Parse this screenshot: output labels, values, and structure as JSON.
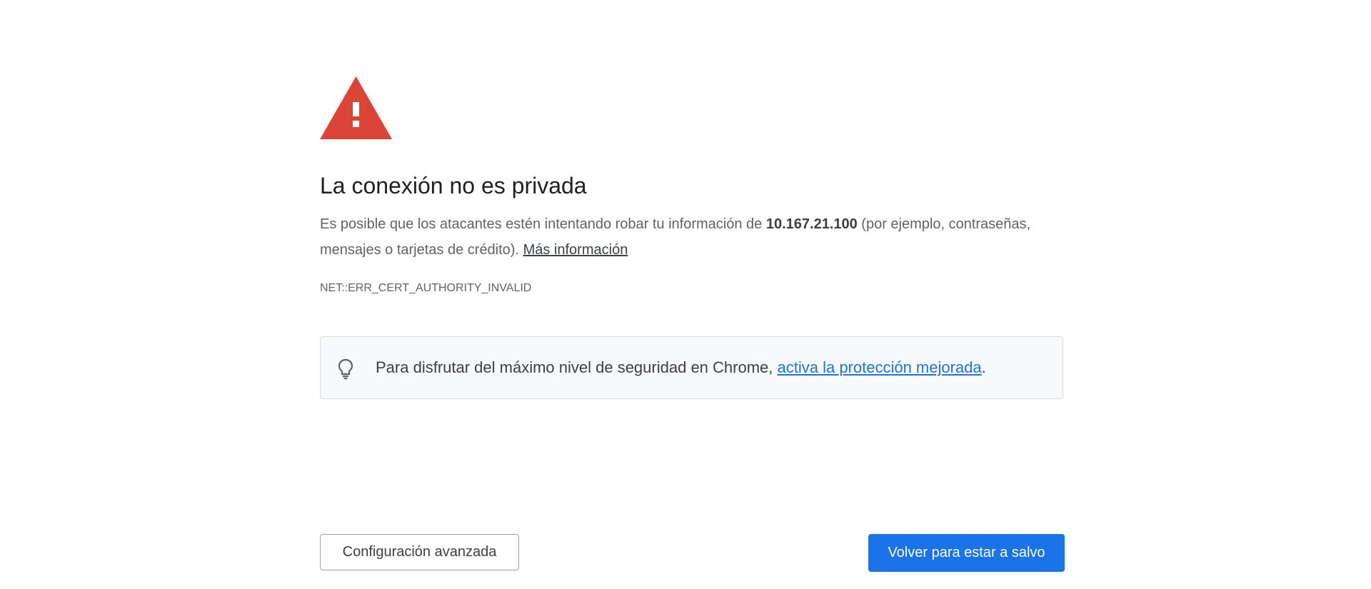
{
  "page": {
    "title": "La conexión no es privada",
    "explanation_before": "Es posible que los atacantes estén intentando robar tu información de ",
    "host": "10.167.21.100",
    "explanation_after": " (por ejemplo, contraseñas, mensajes o tarjetas de crédito). ",
    "learn_more": "Más información",
    "error_code": "NET::ERR_CERT_AUTHORITY_INVALID"
  },
  "tip": {
    "icon": "lightbulb-icon",
    "text_before": "Para disfrutar del máximo nivel de seguridad en Chrome, ",
    "link": "activa la protección mejorada",
    "text_after": "."
  },
  "buttons": {
    "advanced": "Configuración avanzada",
    "back": "Volver para estar a salvo"
  },
  "colors": {
    "warning": "#db4437",
    "primary": "#1a73e8",
    "link": "#1a73e8"
  }
}
